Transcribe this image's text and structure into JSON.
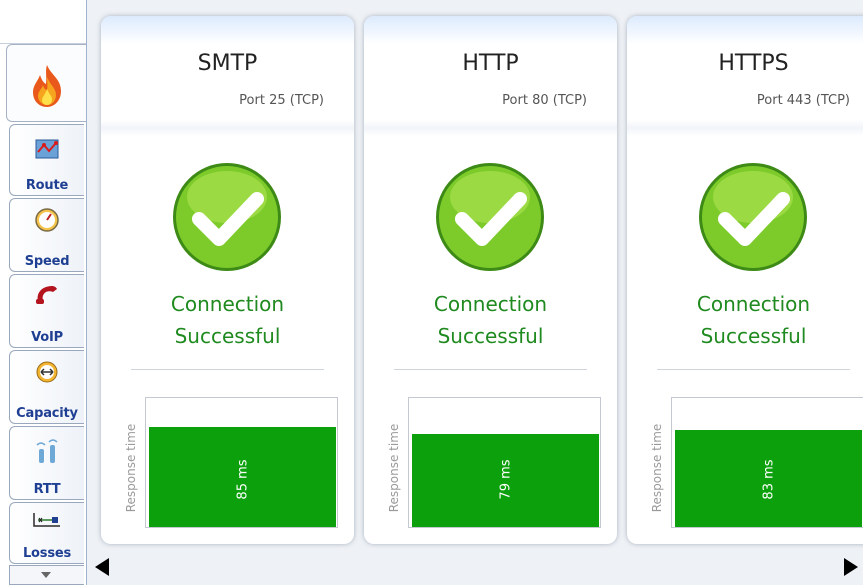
{
  "sidebar": {
    "tabs": [
      {
        "label": "",
        "icon": "flame-icon",
        "active": true
      },
      {
        "label": "Route",
        "icon": "route-icon"
      },
      {
        "label": "Speed",
        "icon": "speedometer-icon"
      },
      {
        "label": "VoIP",
        "icon": "phone-icon"
      },
      {
        "label": "Capacity",
        "icon": "capacity-icon"
      },
      {
        "label": "RTT",
        "icon": "rtt-icon"
      },
      {
        "label": "Losses",
        "icon": "losses-icon"
      }
    ]
  },
  "cards": [
    {
      "title": "SMTP",
      "port": "Port 25 (TCP)",
      "status_line1": "Connection",
      "status_line2": "Successful",
      "axis_label": "Response time",
      "response": "85 ms",
      "response_value_ms": 85
    },
    {
      "title": "HTTP",
      "port": "Port 80 (TCP)",
      "status_line1": "Connection",
      "status_line2": "Successful",
      "axis_label": "Response time",
      "response": "79 ms",
      "response_value_ms": 79
    },
    {
      "title": "HTTPS",
      "port": "Port 443 (TCP)",
      "status_line1": "Connection",
      "status_line2": "Successful",
      "axis_label": "Response time",
      "response": "83 ms",
      "response_value_ms": 83
    }
  ],
  "colors": {
    "success_green": "#1f8a1f",
    "bar_green": "#0ca00c",
    "tab_label_blue": "#1f3f93"
  }
}
